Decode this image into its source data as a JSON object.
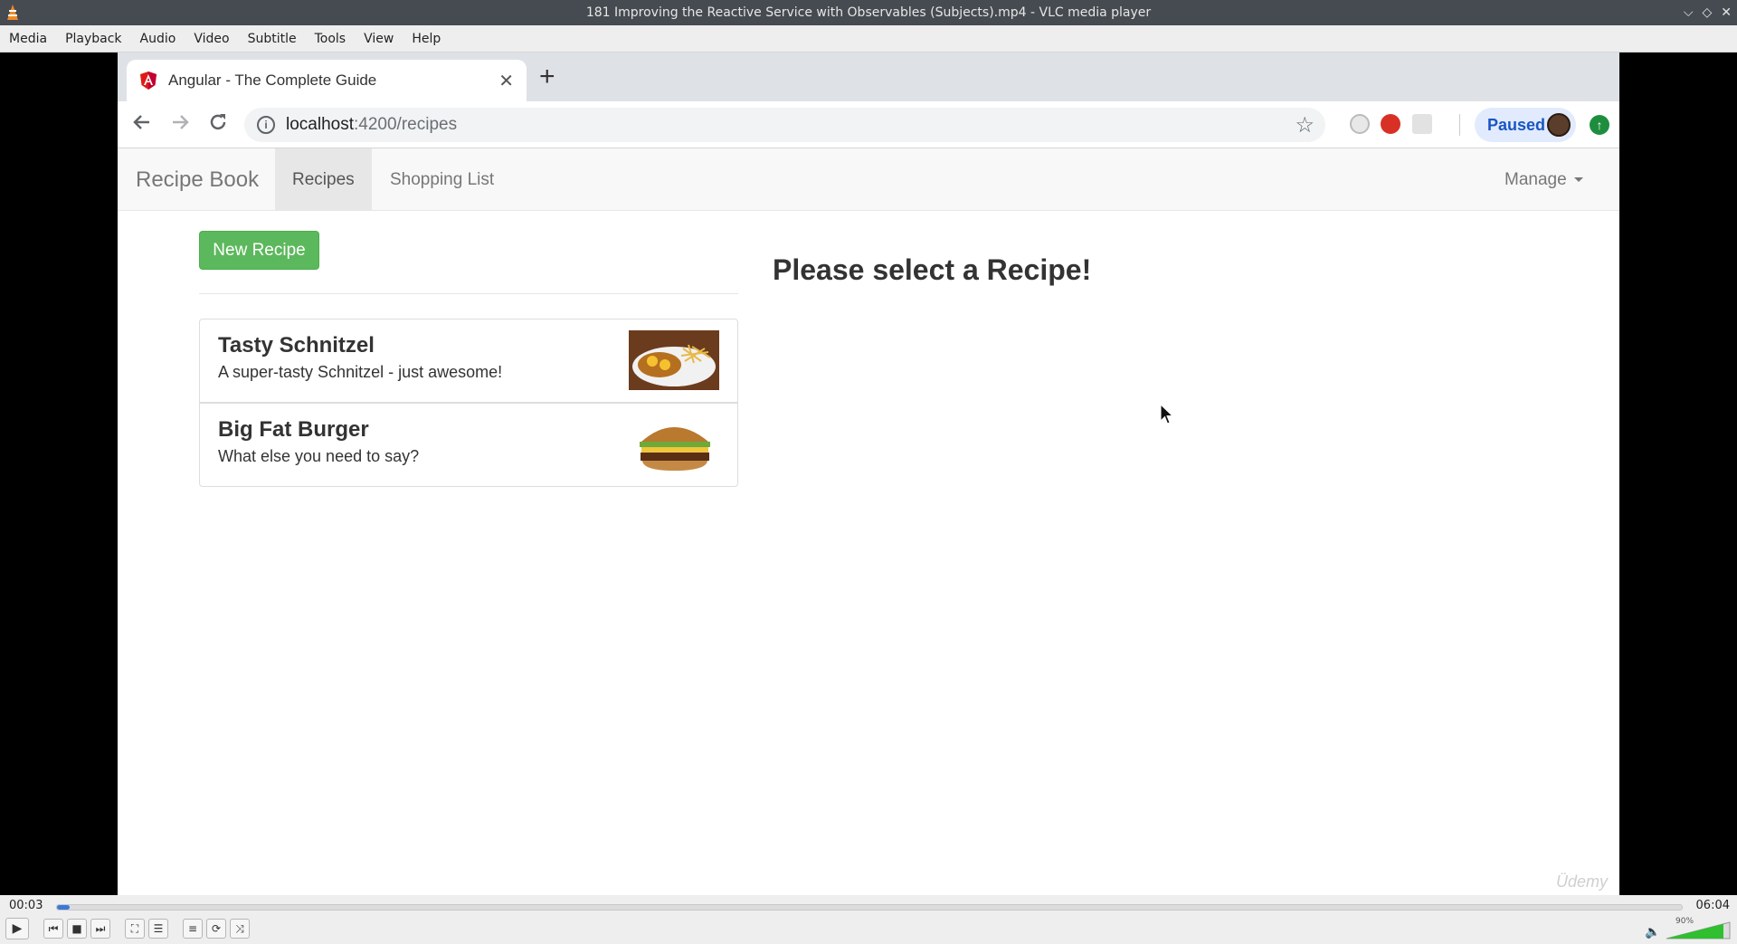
{
  "window": {
    "title": "181 Improving the Reactive Service with Observables (Subjects).mp4 - VLC media player",
    "controls": [
      "⌵",
      "◇",
      "✕"
    ]
  },
  "menu": [
    "Media",
    "Playback",
    "Audio",
    "Video",
    "Subtitle",
    "Tools",
    "View",
    "Help"
  ],
  "browser": {
    "tab_title": "Angular - The Complete Guide",
    "tab_close": "✕",
    "new_tab": "+",
    "url_host": "localhost",
    "url_path": ":4200/recipes",
    "profile_status": "Paused"
  },
  "app": {
    "brand": "Recipe Book",
    "nav": [
      "Recipes",
      "Shopping List"
    ],
    "manage_label": "Manage",
    "new_recipe_label": "New Recipe",
    "placeholder": "Please select a Recipe!",
    "recipes": [
      {
        "name": "Tasty Schnitzel",
        "description": "A super-tasty Schnitzel - just awesome!"
      },
      {
        "name": "Big Fat Burger",
        "description": "What else you need to say?"
      }
    ],
    "watermark": "Üdemy"
  },
  "player": {
    "elapsed": "00:03",
    "total": "06:04",
    "progress_fraction": 0.008,
    "volume_label": "90%",
    "volume_fraction": 0.9,
    "accent": "#3b78d8"
  }
}
